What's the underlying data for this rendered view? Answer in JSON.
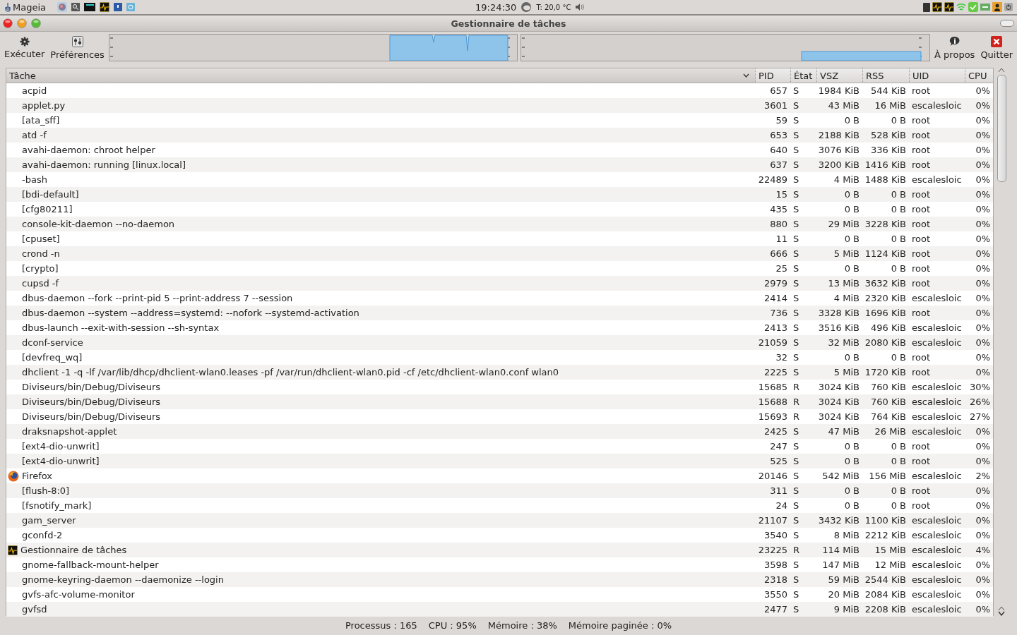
{
  "top_panel": {
    "menu": "Mageia",
    "clock": "19:24:30",
    "temperature": "T: 20,0 °C"
  },
  "window": {
    "title": "Gestionnaire de tâches"
  },
  "toolbar": {
    "buttons": [
      {
        "kind": "run",
        "label": "Exécuter"
      },
      {
        "kind": "prefs",
        "label": "Préférences"
      },
      {
        "kind": "about",
        "label": "À propos"
      },
      {
        "kind": "quit",
        "label": "Quitter"
      }
    ]
  },
  "table": {
    "columns": [
      {
        "label": "Tâche",
        "sorted": true
      },
      {
        "label": "PID",
        "sorted": false
      },
      {
        "label": "État",
        "sorted": false
      },
      {
        "label": "VSZ",
        "sorted": false
      },
      {
        "label": "RSS",
        "sorted": false
      },
      {
        "label": "UID",
        "sorted": false
      },
      {
        "label": "CPU",
        "sorted": false
      }
    ],
    "rows": [
      {
        "task": "acpid",
        "pid": "657",
        "state": "S",
        "vsz": "1984 KiB",
        "rss": "544 KiB",
        "uid": "root",
        "cpu": "0%"
      },
      {
        "task": "applet.py",
        "pid": "3601",
        "state": "S",
        "vsz": "43 MiB",
        "rss": "16 MiB",
        "uid": "escalesloic",
        "cpu": "0%"
      },
      {
        "task": "[ata_sff]",
        "pid": "59",
        "state": "S",
        "vsz": "0 B",
        "rss": "0 B",
        "uid": "root",
        "cpu": "0%"
      },
      {
        "task": "atd -f",
        "pid": "653",
        "state": "S",
        "vsz": "2188 KiB",
        "rss": "528 KiB",
        "uid": "root",
        "cpu": "0%"
      },
      {
        "task": "avahi-daemon: chroot helper",
        "pid": "640",
        "state": "S",
        "vsz": "3076 KiB",
        "rss": "336 KiB",
        "uid": "root",
        "cpu": "0%"
      },
      {
        "task": "avahi-daemon: running [linux.local]",
        "pid": "637",
        "state": "S",
        "vsz": "3200 KiB",
        "rss": "1416 KiB",
        "uid": "root",
        "cpu": "0%"
      },
      {
        "task": "-bash",
        "pid": "22489",
        "state": "S",
        "vsz": "4 MiB",
        "rss": "1488 KiB",
        "uid": "escalesloic",
        "cpu": "0%"
      },
      {
        "task": "[bdi-default]",
        "pid": "15",
        "state": "S",
        "vsz": "0 B",
        "rss": "0 B",
        "uid": "root",
        "cpu": "0%"
      },
      {
        "task": "[cfg80211]",
        "pid": "435",
        "state": "S",
        "vsz": "0 B",
        "rss": "0 B",
        "uid": "root",
        "cpu": "0%"
      },
      {
        "task": "console-kit-daemon --no-daemon",
        "pid": "880",
        "state": "S",
        "vsz": "29 MiB",
        "rss": "3228 KiB",
        "uid": "root",
        "cpu": "0%"
      },
      {
        "task": "[cpuset]",
        "pid": "11",
        "state": "S",
        "vsz": "0 B",
        "rss": "0 B",
        "uid": "root",
        "cpu": "0%"
      },
      {
        "task": "crond -n",
        "pid": "666",
        "state": "S",
        "vsz": "5 MiB",
        "rss": "1124 KiB",
        "uid": "root",
        "cpu": "0%"
      },
      {
        "task": "[crypto]",
        "pid": "25",
        "state": "S",
        "vsz": "0 B",
        "rss": "0 B",
        "uid": "root",
        "cpu": "0%"
      },
      {
        "task": "cupsd -f",
        "pid": "2979",
        "state": "S",
        "vsz": "13 MiB",
        "rss": "3632 KiB",
        "uid": "root",
        "cpu": "0%"
      },
      {
        "task": "dbus-daemon --fork --print-pid 5 --print-address 7 --session",
        "pid": "2414",
        "state": "S",
        "vsz": "4 MiB",
        "rss": "2320 KiB",
        "uid": "escalesloic",
        "cpu": "0%"
      },
      {
        "task": "dbus-daemon --system --address=systemd: --nofork --systemd-activation",
        "pid": "736",
        "state": "S",
        "vsz": "3328 KiB",
        "rss": "1696 KiB",
        "uid": "root",
        "cpu": "0%"
      },
      {
        "task": "dbus-launch --exit-with-session --sh-syntax",
        "pid": "2413",
        "state": "S",
        "vsz": "3516 KiB",
        "rss": "496 KiB",
        "uid": "escalesloic",
        "cpu": "0%"
      },
      {
        "task": "dconf-service",
        "pid": "21059",
        "state": "S",
        "vsz": "32 MiB",
        "rss": "2080 KiB",
        "uid": "escalesloic",
        "cpu": "0%"
      },
      {
        "task": "[devfreq_wq]",
        "pid": "32",
        "state": "S",
        "vsz": "0 B",
        "rss": "0 B",
        "uid": "root",
        "cpu": "0%"
      },
      {
        "task": "dhclient -1 -q -lf /var/lib/dhcp/dhclient-wlan0.leases -pf /var/run/dhclient-wlan0.pid -cf /etc/dhclient-wlan0.conf wlan0",
        "pid": "2225",
        "state": "S",
        "vsz": "5 MiB",
        "rss": "1720 KiB",
        "uid": "root",
        "cpu": "0%"
      },
      {
        "task": "Diviseurs/bin/Debug/Diviseurs",
        "pid": "15685",
        "state": "R",
        "vsz": "3024 KiB",
        "rss": "760 KiB",
        "uid": "escalesloic",
        "cpu": "30%"
      },
      {
        "task": "Diviseurs/bin/Debug/Diviseurs",
        "pid": "15688",
        "state": "R",
        "vsz": "3024 KiB",
        "rss": "760 KiB",
        "uid": "escalesloic",
        "cpu": "26%"
      },
      {
        "task": "Diviseurs/bin/Debug/Diviseurs",
        "pid": "15693",
        "state": "R",
        "vsz": "3024 KiB",
        "rss": "764 KiB",
        "uid": "escalesloic",
        "cpu": "27%"
      },
      {
        "task": "draksnapshot-applet",
        "pid": "2425",
        "state": "S",
        "vsz": "47 MiB",
        "rss": "26 MiB",
        "uid": "escalesloic",
        "cpu": "0%"
      },
      {
        "task": "[ext4-dio-unwrit]",
        "pid": "247",
        "state": "S",
        "vsz": "0 B",
        "rss": "0 B",
        "uid": "root",
        "cpu": "0%"
      },
      {
        "task": "[ext4-dio-unwrit]",
        "pid": "525",
        "state": "S",
        "vsz": "0 B",
        "rss": "0 B",
        "uid": "root",
        "cpu": "0%"
      },
      {
        "task": "Firefox",
        "kind": "browser",
        "pid": "20146",
        "state": "S",
        "vsz": "542 MiB",
        "rss": "156 MiB",
        "uid": "escalesloic",
        "cpu": "2%"
      },
      {
        "task": "[flush-8:0]",
        "pid": "311",
        "state": "S",
        "vsz": "0 B",
        "rss": "0 B",
        "uid": "root",
        "cpu": "0%"
      },
      {
        "task": "[fsnotify_mark]",
        "pid": "24",
        "state": "S",
        "vsz": "0 B",
        "rss": "0 B",
        "uid": "root",
        "cpu": "0%"
      },
      {
        "task": "gam_server",
        "pid": "21107",
        "state": "S",
        "vsz": "3432 KiB",
        "rss": "1100 KiB",
        "uid": "escalesloic",
        "cpu": "0%"
      },
      {
        "task": "gconfd-2",
        "pid": "3540",
        "state": "S",
        "vsz": "8 MiB",
        "rss": "2212 KiB",
        "uid": "escalesloic",
        "cpu": "0%"
      },
      {
        "task": "Gestionnaire de tâches",
        "kind": "monitor",
        "pid": "23225",
        "state": "R",
        "vsz": "114 MiB",
        "rss": "15 MiB",
        "uid": "escalesloic",
        "cpu": "4%"
      },
      {
        "task": "gnome-fallback-mount-helper",
        "pid": "3598",
        "state": "S",
        "vsz": "147 MiB",
        "rss": "12 MiB",
        "uid": "escalesloic",
        "cpu": "0%"
      },
      {
        "task": "gnome-keyring-daemon --daemonize --login",
        "pid": "2318",
        "state": "S",
        "vsz": "59 MiB",
        "rss": "2544 KiB",
        "uid": "escalesloic",
        "cpu": "0%"
      },
      {
        "task": "gvfs-afc-volume-monitor",
        "pid": "3550",
        "state": "S",
        "vsz": "20 MiB",
        "rss": "2084 KiB",
        "uid": "escalesloic",
        "cpu": "0%"
      },
      {
        "task": "gvfsd",
        "pid": "2477",
        "state": "S",
        "vsz": "9 MiB",
        "rss": "2208 KiB",
        "uid": "escalesloic",
        "cpu": "0%"
      }
    ]
  },
  "status_bar": [
    "Processus : 165",
    "CPU : 95%",
    "Mémoire : 38%",
    "Mémoire paginée : 0%"
  ]
}
